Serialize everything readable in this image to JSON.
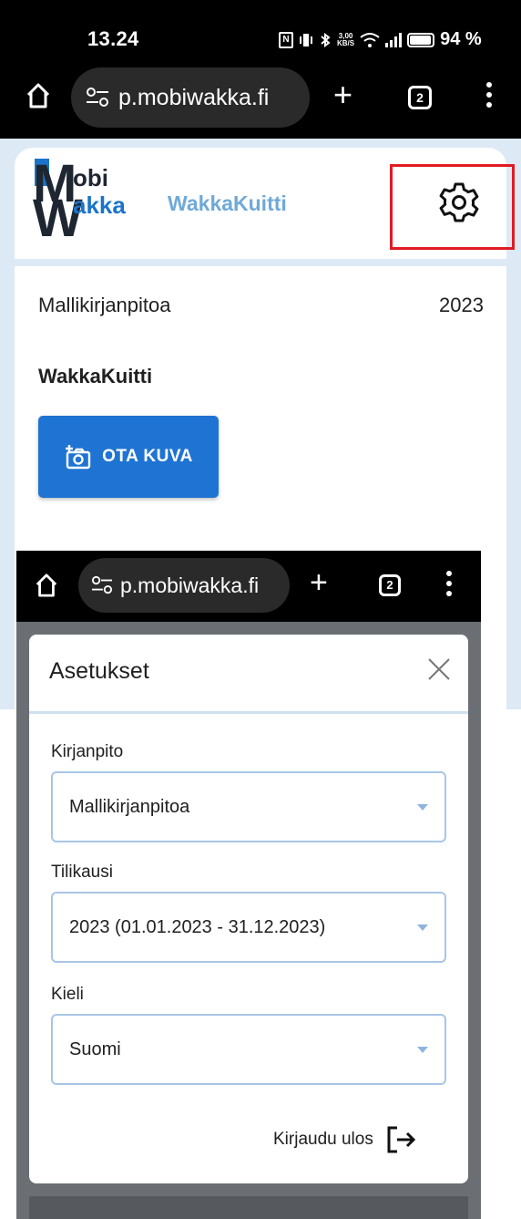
{
  "status_bar": {
    "time": "13.24",
    "speed_top": "3,00",
    "speed_bottom": "KB/S",
    "battery": "94 %"
  },
  "browser": {
    "url": "p.mobiwakka.fi",
    "tab_count": "2"
  },
  "app": {
    "logo": {
      "m": "M",
      "w": "W",
      "obi": "obi",
      "akka": "akka"
    },
    "title": "WakkaKuitti",
    "organization": "Mallikirjanpitoa",
    "year": "2023",
    "section_title": "WakkaKuitti",
    "camera_button": "OTA KUVA",
    "highlight_color": "#e01b24",
    "accent_color": "#1f74d3"
  },
  "settings_dialog": {
    "title": "Asetukset",
    "fields": [
      {
        "label": "Kirjanpito",
        "value": "Mallikirjanpitoa"
      },
      {
        "label": "Tilikausi",
        "value": "2023 (01.01.2023 - 31.12.2023)"
      },
      {
        "label": "Kieli",
        "value": "Suomi"
      }
    ],
    "logout": "Kirjaudu ulos"
  }
}
